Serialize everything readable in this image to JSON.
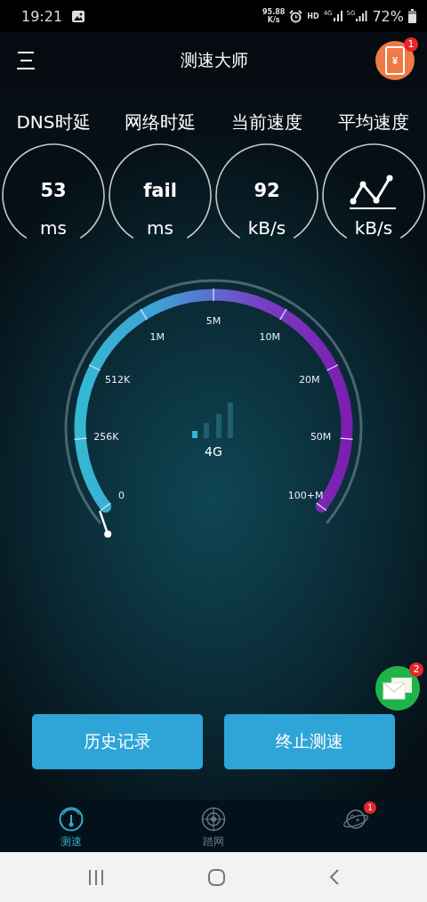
{
  "status_bar": {
    "time": "19:21",
    "net_speed": [
      "95.88",
      "K/s"
    ],
    "hd": "HD",
    "sim_1": "4G",
    "sim_2": "5G",
    "battery": "72%"
  },
  "app_bar": {
    "title": "测速大师",
    "promo": {
      "glyph": "¥",
      "badge": "1"
    }
  },
  "metrics": [
    {
      "label": "DNS时延",
      "kind": "value",
      "value": "53",
      "unit": "ms"
    },
    {
      "label": "网络时延",
      "kind": "value",
      "value": "fail",
      "unit": "ms"
    },
    {
      "label": "当前速度",
      "kind": "value",
      "value": "92",
      "unit": "kB/s"
    },
    {
      "label": "平均速度",
      "kind": "chart",
      "unit": "kB/s"
    }
  ],
  "gauge": {
    "scale": [
      "0",
      "256K",
      "512K",
      "1M",
      "5M",
      "10M",
      "20M",
      "50M",
      "100+M"
    ],
    "network": "4G"
  },
  "message_button": {
    "badge": "2"
  },
  "buttons": [
    "历史记录",
    "终止测速"
  ],
  "tabs": [
    {
      "kind": "speed",
      "label": "测速",
      "selected": true
    },
    {
      "kind": "radar",
      "label": "踏网",
      "selected": false
    },
    {
      "kind": "planet",
      "badge": "1",
      "selected": false
    }
  ]
}
